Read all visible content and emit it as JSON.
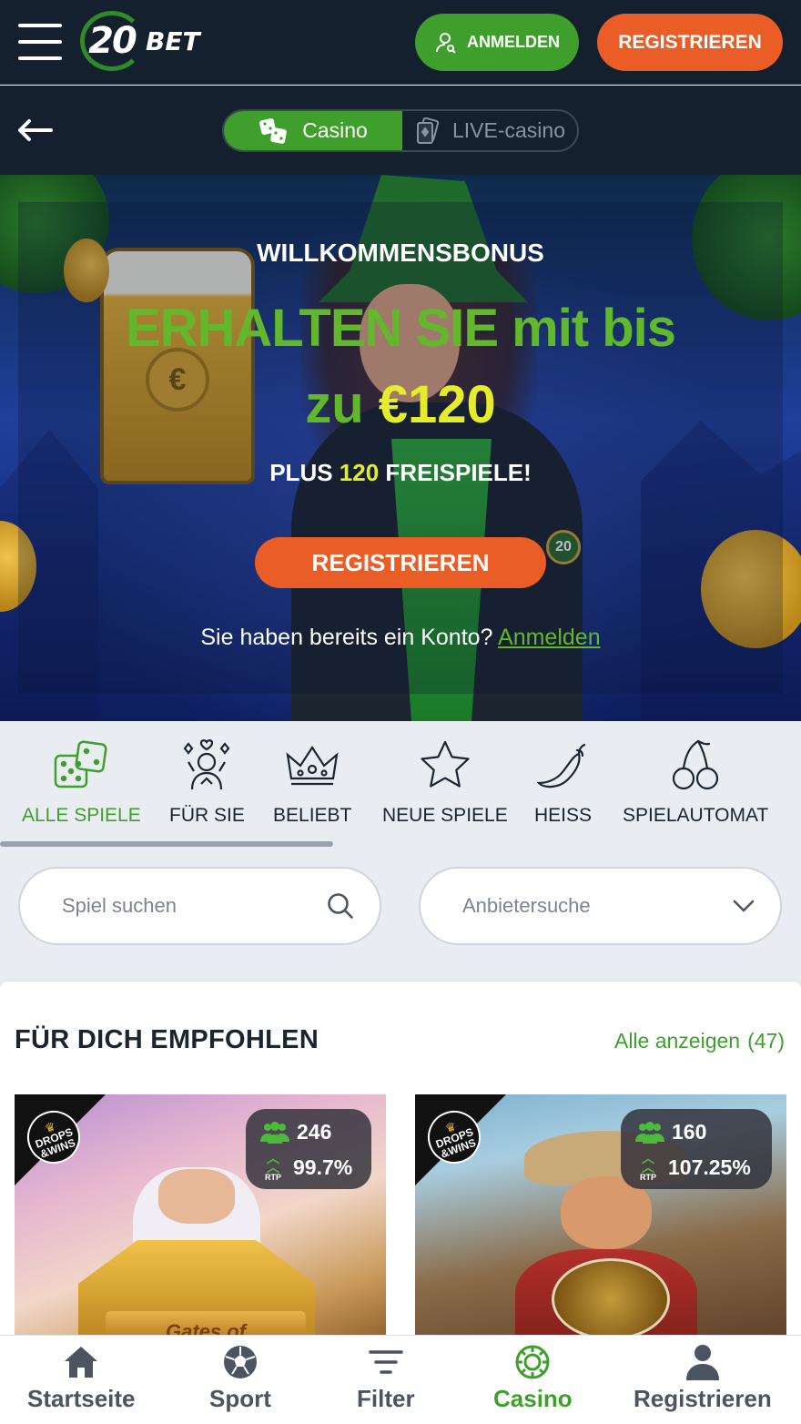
{
  "header": {
    "logo_number": "20",
    "logo_text": "BET",
    "login_label": "ANMELDEN",
    "register_label": "REGISTRIEREN"
  },
  "subnav": {
    "casino_label": "Casino",
    "live_label": "LIVE-casino"
  },
  "hero": {
    "title": "WILLKOMMENSBONUS",
    "headline_1": "ERHALTEN SIE mit bis",
    "headline_2_prefix": "zu",
    "headline_2_amount": "€120",
    "sub_prefix": "PLUS",
    "sub_number": "120",
    "sub_suffix": "FREISPIELE!",
    "cta_label": "REGISTRIEREN",
    "account_text": "Sie haben bereits ein Konto?",
    "account_link": "Anmelden",
    "badge": "20"
  },
  "categories": [
    {
      "label": "ALLE SPIELE",
      "icon": "dice-icon",
      "active": true
    },
    {
      "label": "FÜR SIE",
      "icon": "person-cards-icon",
      "active": false
    },
    {
      "label": "BELIEBT",
      "icon": "crown-icon",
      "active": false
    },
    {
      "label": "NEUE SPIELE",
      "icon": "star-icon",
      "active": false
    },
    {
      "label": "HEISS",
      "icon": "chili-icon",
      "active": false
    },
    {
      "label": "SPIELAUTOMAT",
      "icon": "cherries-icon",
      "active": false
    }
  ],
  "search": {
    "placeholder": "Spiel suchen",
    "provider_placeholder": "Anbietersuche"
  },
  "recommended": {
    "title": "FÜR DICH EMPFOHLEN",
    "show_all": "Alle anzeigen",
    "count": "(47)",
    "games": [
      {
        "players": "246",
        "rtp": "99.7%",
        "tag_line1": "DROPS",
        "tag_line2": "&WINS",
        "sign": "Gates of"
      },
      {
        "players": "160",
        "rtp": "107.25%",
        "tag_line1": "DROPS",
        "tag_line2": "&WINS"
      }
    ],
    "rtp_label": "RTP"
  },
  "bottom_nav": [
    {
      "label": "Startseite",
      "icon": "home-icon",
      "active": false
    },
    {
      "label": "Sport",
      "icon": "soccer-ball-icon",
      "active": false
    },
    {
      "label": "Filter",
      "icon": "filter-icon",
      "active": false
    },
    {
      "label": "Casino",
      "icon": "casino-chip-icon",
      "active": true
    },
    {
      "label": "Registrieren",
      "icon": "user-icon",
      "active": false
    }
  ],
  "colors": {
    "brand_green": "#3f9f2d",
    "brand_orange": "#ea5d27",
    "header_bg": "#14202e",
    "highlight_yellow": "#e4ec2c"
  }
}
